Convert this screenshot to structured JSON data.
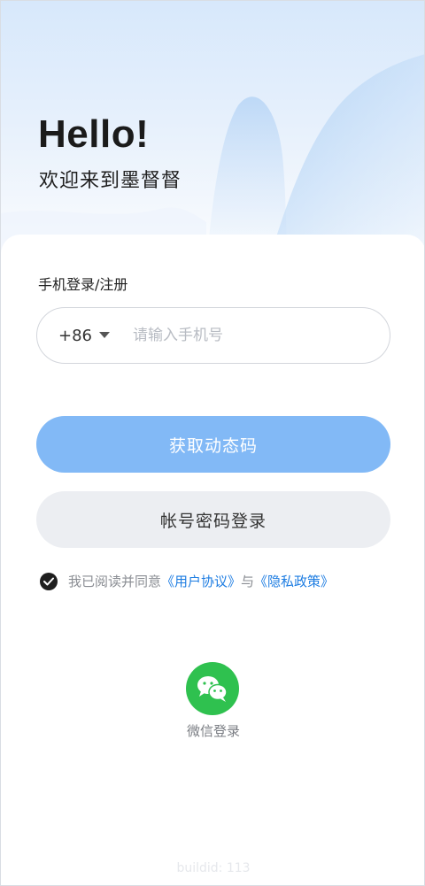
{
  "hero": {
    "title": "Hello!",
    "subtitle": "欢迎来到墨督督"
  },
  "login": {
    "section_label": "手机登录/注册",
    "country_code": "+86",
    "phone_placeholder": "请输入手机号",
    "phone_value": "",
    "get_code_button": "获取动态码",
    "password_login_button": "帐号密码登录"
  },
  "agreement": {
    "checked": true,
    "prefix": "我已阅读并同意",
    "user_agreement": "《用户协议》",
    "conjunction": "与",
    "privacy_policy": "《隐私政策》"
  },
  "wechat": {
    "label": "微信登录",
    "icon": "wechat-icon"
  },
  "footer": {
    "build_id": "buildid: 113"
  },
  "colors": {
    "primary_button": "#82b9f6",
    "secondary_button": "#eceef2",
    "link": "#1e7de2",
    "wechat_green": "#2fc14f"
  }
}
